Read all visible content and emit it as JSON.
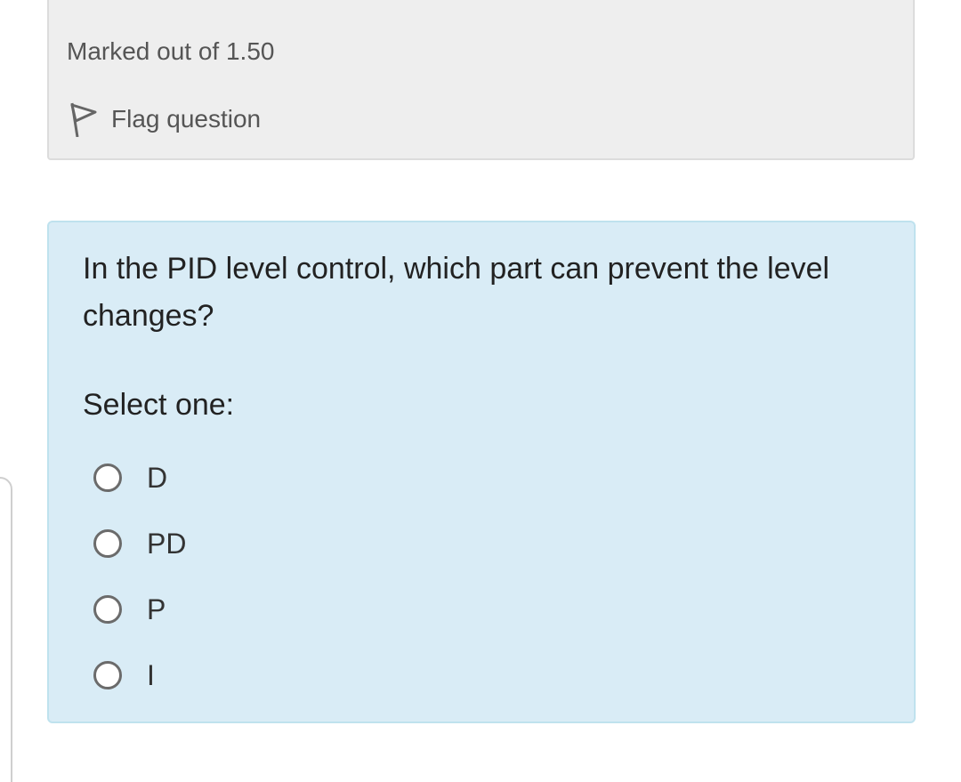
{
  "info": {
    "marked_text": "Marked out of 1.50",
    "flag_label": "Flag question",
    "flag_icon": "flag-icon"
  },
  "question": {
    "text": "In the PID level control, which part can prevent the level changes?",
    "prompt": "Select one:",
    "options": [
      {
        "label": "D",
        "selected": false
      },
      {
        "label": "PD",
        "selected": false
      },
      {
        "label": "P",
        "selected": false
      },
      {
        "label": "I",
        "selected": false
      }
    ]
  },
  "colors": {
    "info_bg": "#eeeeee",
    "question_bg": "#d9ecf6",
    "question_border": "#bfe2ee",
    "text": "#222222",
    "muted_text": "#555555"
  }
}
